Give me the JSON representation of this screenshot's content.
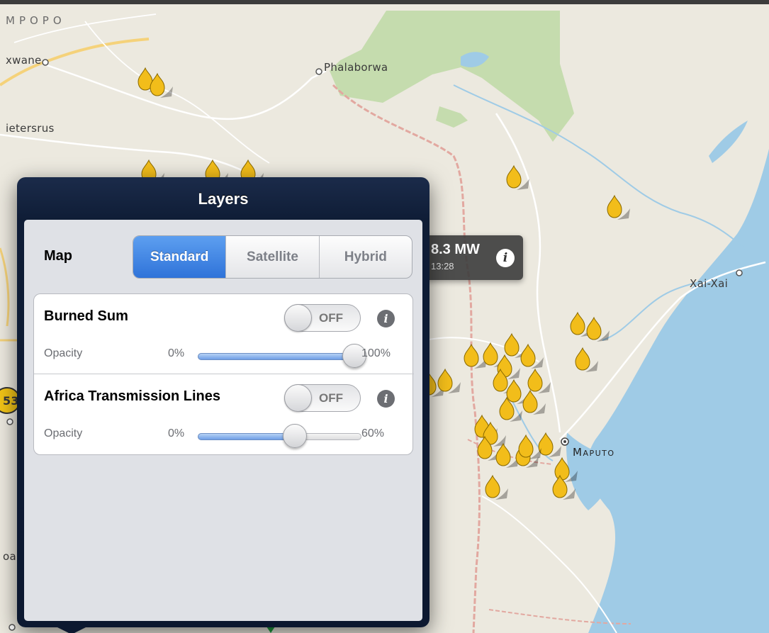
{
  "map": {
    "labels": {
      "region": "MPOPO",
      "town_1": "xwane",
      "town_2": "Phalaborwa",
      "town_3": "ietersrus",
      "town_4": "Xai-Xai",
      "capital": "Maputo",
      "edge_1": "53",
      "edge_2": "oa"
    },
    "callout": {
      "value": "8.3 MW",
      "time": "13:28",
      "info_icon": "info-icon"
    },
    "fire_icon": "flame-icon",
    "colors": {
      "land": "#ece9df",
      "park": "#c5dcae",
      "water": "#9fcbe6",
      "border": "#e2a8a0",
      "roads": "#ffffff",
      "fire": "#f2bd1a"
    }
  },
  "popover": {
    "title": "Layers",
    "map_row_label": "Map",
    "map_types": [
      "Standard",
      "Satellite",
      "Hybrid"
    ],
    "selected_map_type": "Standard",
    "layers": [
      {
        "name": "Burned Sum",
        "toggle": "OFF",
        "opacity_label": "Opacity",
        "opacity_min": "0%",
        "opacity_max": "100%",
        "opacity_value": 1.0
      },
      {
        "name": "Africa Transmission Lines",
        "toggle": "OFF",
        "opacity_label": "Opacity",
        "opacity_min": "0%",
        "opacity_max": "60%",
        "opacity_value": 0.6
      }
    ],
    "colors": {
      "header": "#13213c",
      "segment_active": "#3b7fe0"
    }
  }
}
